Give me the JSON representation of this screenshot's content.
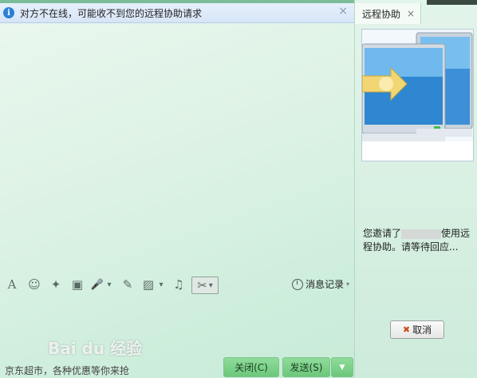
{
  "notice": {
    "text": "对方不在线，可能收不到您的远程协助请求",
    "close_glyph": "×",
    "info_glyph": "i"
  },
  "right_panel": {
    "tab_label": "远程协助",
    "tab_close": "×",
    "message_prefix": "您邀请了",
    "message_suffix": "使用远程协助。请等待回应...",
    "cancel_label": "取消"
  },
  "toolbar": {
    "font_glyph": "A",
    "emoji_glyph": "☺",
    "magic_glyph": "✦",
    "video_glyph": "▣",
    "voice_glyph": "🎤",
    "edit_glyph": "✎",
    "image_glyph": "▨",
    "music_glyph": "♫",
    "scissors_glyph": "✂",
    "dropdown_glyph": "▾",
    "history_label": "消息记录"
  },
  "bottom": {
    "ad_text": "京东超市，各种优惠等你来抢",
    "close_label": "关闭(C)",
    "send_label": "发送(S)",
    "send_arrow": "▼"
  },
  "watermark": "Bai du 经验",
  "colors": {
    "accent_green": "#6cc77a",
    "info_blue": "#2b7fd6"
  }
}
